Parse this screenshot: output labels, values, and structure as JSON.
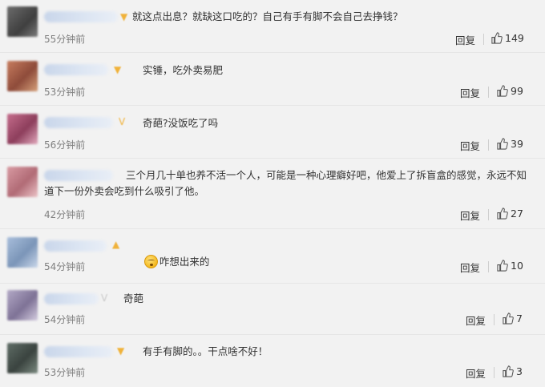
{
  "comments": [
    {
      "text": "就这点出息？就缺这口吃的？自己有手有脚不会自己去挣钱？",
      "time": "55分钟前",
      "reply": "回复",
      "likes": "149",
      "avatar_color": "#5a5a5a",
      "has_emoji": false
    },
    {
      "text": "实锤，吃外卖易肥",
      "time": "53分钟前",
      "reply": "回复",
      "likes": "99",
      "avatar_color": "#b06a55",
      "has_emoji": false
    },
    {
      "text": "奇葩?没饭吃了吗",
      "time": "56分钟前",
      "reply": "回复",
      "likes": "39",
      "avatar_color": "#b85b7a",
      "has_emoji": false
    },
    {
      "text": "三个月几十单也养不活一个人，可能是一种心理癖好吧，他爱上了拆盲盒的感觉，永远不知道下一份外卖会吃到什么吸引了他。",
      "time": "42分钟前",
      "reply": "回复",
      "likes": "27",
      "avatar_color": "#c98a93",
      "has_emoji": false
    },
    {
      "text": "咋想出来的",
      "time": "54分钟前",
      "reply": "回复",
      "likes": "10",
      "avatar_color": "#8fa7c7",
      "has_emoji": true
    },
    {
      "text": "奇葩",
      "time": "54分钟前",
      "reply": "回复",
      "likes": "7",
      "avatar_color": "#9a8fae",
      "has_emoji": false
    },
    {
      "text": "有手有脚的。。干点啥不好！",
      "time": "53分钟前",
      "reply": "回复",
      "likes": "3",
      "avatar_color": "#4f5a55",
      "has_emoji": false
    }
  ]
}
